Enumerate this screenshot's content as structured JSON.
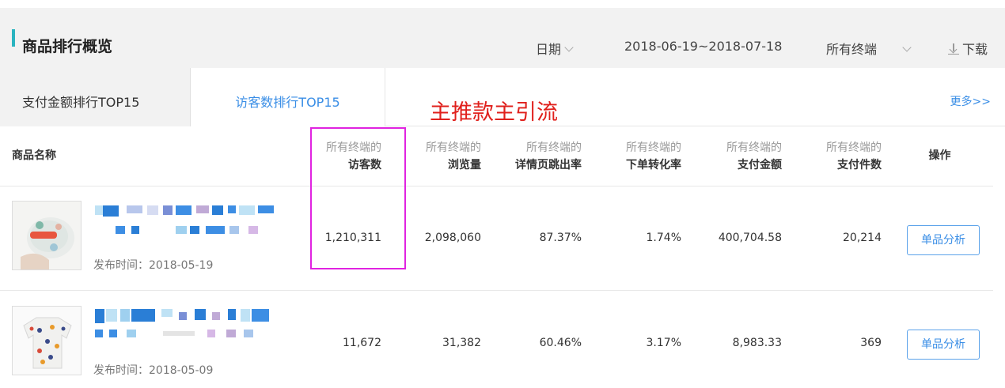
{
  "header": {
    "title": "商品排行概览",
    "date_label": "日期",
    "date_range": "2018-06-19~2018-07-18",
    "terminal": "所有终端",
    "download": "下载"
  },
  "tabs": {
    "tab1": "支付金额排行TOP15",
    "tab2": "访客数排行TOP15",
    "more": "更多>>"
  },
  "annotation": "主推款主引流",
  "table": {
    "name_header": "商品名称",
    "columns": [
      {
        "line1": "所有终端的",
        "line2": "访客数"
      },
      {
        "line1": "所有终端的",
        "line2": "浏览量"
      },
      {
        "line1": "所有终端的",
        "line2": "详情页跳出率"
      },
      {
        "line1": "所有终端的",
        "line2": "下单转化率"
      },
      {
        "line1": "所有终端的",
        "line2": "支付金额"
      },
      {
        "line1": "所有终端的",
        "line2": "支付件数"
      }
    ],
    "op_header": "操作",
    "rows": [
      {
        "publish": "发布时间：2018-05-19",
        "values": [
          "1,210,311",
          "2,098,060",
          "87.37%",
          "1.74%",
          "400,704.58",
          "20,214"
        ],
        "button": "单品分析"
      },
      {
        "publish": "发布时间：2018-05-09",
        "values": [
          "11,672",
          "31,382",
          "60.46%",
          "3.17%",
          "8,983.33",
          "369"
        ],
        "button": "单品分析"
      }
    ]
  },
  "colors": {
    "accent": "#2bb4c0",
    "link": "#3a8ee6",
    "annotation": "#e0201c",
    "highlight_box": "#e023e0"
  }
}
